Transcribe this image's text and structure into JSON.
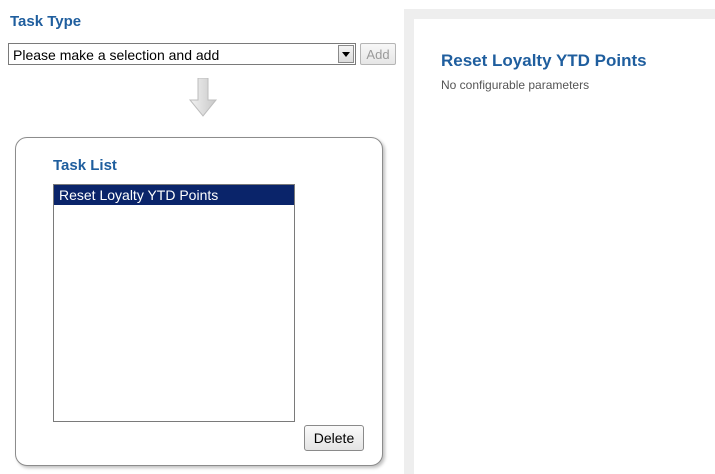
{
  "task_type": {
    "heading": "Task Type",
    "select_value": "Please make a selection and add",
    "add_label": "Add"
  },
  "task_list": {
    "heading": "Task List",
    "items": [
      "Reset Loyalty YTD Points"
    ],
    "selected_index": 0,
    "delete_label": "Delete"
  },
  "detail": {
    "title": "Reset Loyalty YTD Points",
    "subtitle": "No configurable parameters"
  },
  "colors": {
    "heading_blue": "#1f5e9e",
    "selection_navy": "#0a246a"
  },
  "icons": {
    "arrow": "arrow-down-icon",
    "dropdown": "chevron-down-icon"
  }
}
